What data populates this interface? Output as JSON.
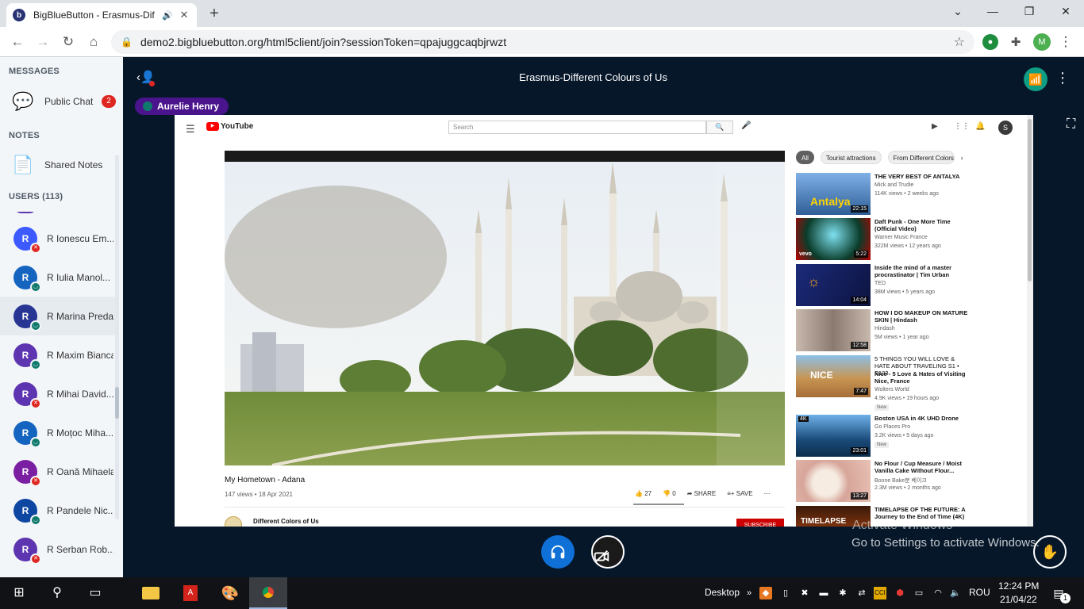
{
  "browser": {
    "tab_title": "BigBlueButton - Erasmus-Dif",
    "tab_favicon": "b",
    "url": "demo2.bigbluebutton.org/html5client/join?sessionToken=qpajuggcaqbjrwzt",
    "profile_initial": "M"
  },
  "sidebar": {
    "messages_title": "MESSAGES",
    "public_chat_label": "Public Chat",
    "public_chat_badge": "2",
    "notes_title": "NOTES",
    "shared_notes_label": "Shared Notes",
    "users_title": "USERS (113)",
    "users": [
      {
        "initial": "R",
        "name": "R Ionescu Em...",
        "color": "#3d5afe",
        "mic": "muted"
      },
      {
        "initial": "R",
        "name": "R Iulia Manol...",
        "color": "#1565c0",
        "mic": "listen"
      },
      {
        "initial": "R",
        "name": "R Marina Preda",
        "color": "#283593",
        "mic": "listen",
        "active": true
      },
      {
        "initial": "R",
        "name": "R Maxim Bianca",
        "color": "#5e35b1",
        "mic": "listen"
      },
      {
        "initial": "R",
        "name": "R Mihai David...",
        "color": "#5e35b1",
        "mic": "muted"
      },
      {
        "initial": "R",
        "name": "R Moțoc Miha...",
        "color": "#1565c0",
        "mic": "listen"
      },
      {
        "initial": "R",
        "name": "R Oană Mihaela",
        "color": "#7b1fa2",
        "mic": "muted"
      },
      {
        "initial": "R",
        "name": "R Pandele Nic...",
        "color": "#0d47a1",
        "mic": "listen"
      },
      {
        "initial": "R",
        "name": "R Serban Rob...",
        "color": "#5e35b1",
        "mic": "muted"
      }
    ]
  },
  "meeting": {
    "title": "Erasmus-Different Colours of Us",
    "talker": "Aurelie Henry",
    "watermark_line1": "Activate Windows",
    "watermark_line2": "Go to Settings to activate Windows."
  },
  "youtube": {
    "logo_text": "YouTube",
    "search_placeholder": "Search",
    "account_initial": "S",
    "video_title": "My Hometown - Adana",
    "video_meta": "147 views • 18 Apr 2021",
    "likes": "27",
    "dislikes": "0",
    "share_label": "SHARE",
    "save_label": "SAVE",
    "channel_name": "Different Colors of Us",
    "subscribe_label": "SUBSCRIBE",
    "chips": [
      "All",
      "Tourist attractions",
      "From Different Colors"
    ],
    "recommendations": [
      {
        "title": "THE VERY BEST OF ANTALYA",
        "channel": "Mick and Trudie",
        "views": "114K views • 2 weeks ago",
        "duration": "22:15",
        "thumb_color": "#3b6fb5",
        "thumb_text": "Antalya"
      },
      {
        "title": "Daft Punk - One More Time (Official Video)",
        "channel": "Warner Music France",
        "views": "322M views • 12 years ago",
        "duration": "5:22",
        "thumb_color": "#0a6b3a",
        "thumb_text": "vevo"
      },
      {
        "title": "Inside the mind of a master procrastinator | Tim Urban",
        "channel": "TED",
        "views": "38M views • 5 years ago",
        "duration": "14:04",
        "thumb_color": "#15205e",
        "thumb_text": ""
      },
      {
        "title": "HOW I DO MAKEUP ON MATURE SKIN | Hindash",
        "channel": "Hindash",
        "views": "5M views • 1 year ago",
        "duration": "12:58",
        "thumb_color": "#8a7a72",
        "thumb_text": ""
      },
      {
        "title": "5 THINGS YOU WILL LOVE & HATE ABOUT TRAVELING S1 • E123",
        "title2": "Nice - 5 Love & Hates of Visiting Nice, France",
        "channel": "Wolters World",
        "views": "4.9K views • 19 hours ago",
        "new": "New",
        "duration": "7:47",
        "thumb_color": "#c08a4a",
        "thumb_text": "NICE"
      },
      {
        "title": "Boston USA in 4K UHD Drone",
        "channel": "Go Places Pro",
        "views": "3.2K views • 5 days ago",
        "new": "New",
        "duration": "23:01",
        "thumb_color": "#1e6fa8",
        "thumb_text": "4K"
      },
      {
        "title": "No Flour / Cup Measure / Moist Vanilla Cake Without Flour...",
        "channel": "Boone Bake분 베이크",
        "views": "2.3M views • 2 months ago",
        "duration": "13:27",
        "thumb_color": "#e9b7a8",
        "thumb_text": ""
      },
      {
        "title": "TIMELAPSE OF THE FUTURE: A Journey to the End of Time (4K)",
        "channel": "",
        "views": "",
        "duration": "",
        "thumb_color": "#2a1208",
        "thumb_text": "TIMELAPSE"
      }
    ]
  },
  "taskbar": {
    "desktop_label": "Desktop",
    "lang": "ROU",
    "time": "12:24 PM",
    "date": "21/04/22",
    "notif_count": "1"
  }
}
